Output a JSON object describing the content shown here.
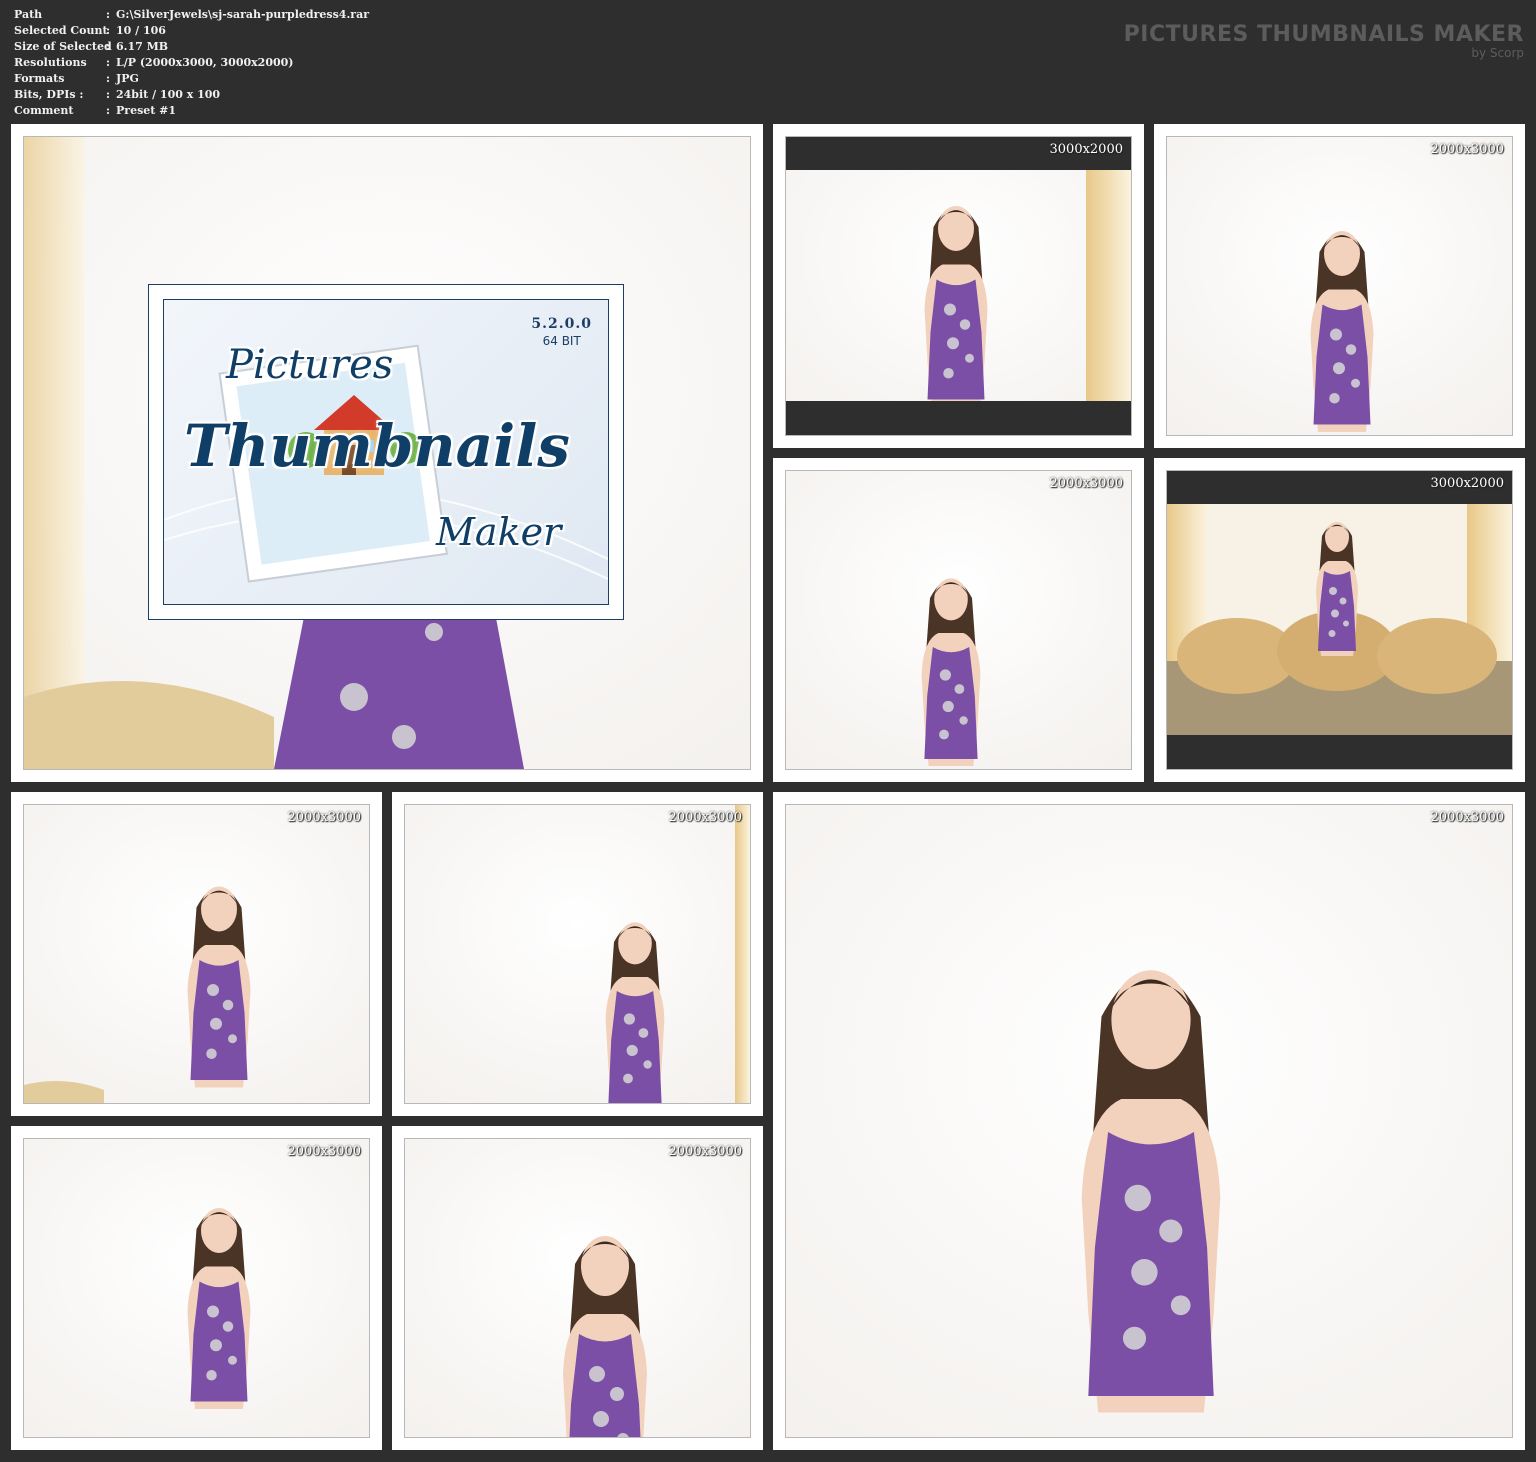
{
  "info": [
    {
      "key": "Path",
      "value": "G:\\SilverJewels\\sj-sarah-purpledress4.rar"
    },
    {
      "key": "Selected Count",
      "value": "10 / 106"
    },
    {
      "key": "Size of Selected",
      "value": "6.17 MB"
    },
    {
      "key": "Resolutions",
      "value": "L/P (2000x3000, 3000x2000)"
    },
    {
      "key": "Formats",
      "value": "JPG"
    },
    {
      "key": "Bits, DPIs :",
      "value": "24bit / 100 x 100"
    },
    {
      "key": "Comment",
      "value": "Preset #1"
    }
  ],
  "separator": ":",
  "brand": {
    "title": "PICTURES THUMBNAILS MAKER",
    "subtitle": "by Scorp"
  },
  "logo": {
    "version": "5.2.0.0",
    "bits": "64 BIT",
    "word1": "Pictures",
    "word2": "Thumbnails",
    "word3": "Maker"
  },
  "thumbnails": [
    {
      "dim": "3000x2000"
    },
    {
      "dim": "2000x3000"
    },
    {
      "dim": "2000x3000"
    },
    {
      "dim": "3000x2000"
    },
    {
      "dim": "2000x3000"
    },
    {
      "dim": "2000x3000"
    },
    {
      "dim": "2000x3000"
    },
    {
      "dim": "2000x3000"
    },
    {
      "dim": "2000x3000"
    }
  ],
  "colors": {
    "background": "#2e2e2e",
    "dress": "#7b4fa6",
    "hair": "#4a3426",
    "logo_blue": "#0f3e66"
  }
}
